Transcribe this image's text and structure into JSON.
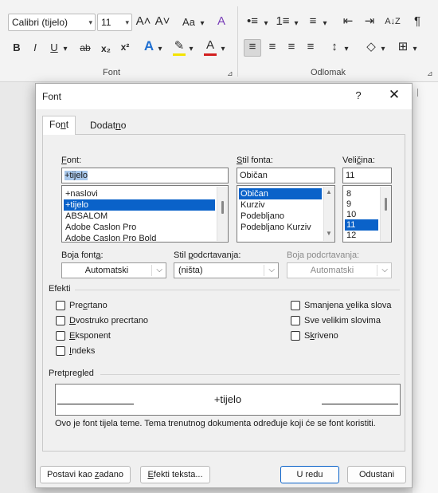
{
  "ribbon": {
    "font_name": "Calibri (tijelo)",
    "font_size": "11",
    "font_group_label": "Font",
    "paragraph_group_label": "Odlomak",
    "icons": {
      "grow": "A˄",
      "shrink": "A˅",
      "change_case": "Aa",
      "clear_format": "A",
      "bold": "B",
      "italic": "I",
      "underline": "U",
      "strike": "ab",
      "subscript": "x₂",
      "superscript": "x²",
      "text_effects": "A",
      "highlight": "✎",
      "font_color": "A",
      "bullets": "•≡",
      "numbering": "1≡",
      "multilevel": "≡",
      "decrease_indent": "⇤",
      "increase_indent": "⇥",
      "sort": "A↓Z",
      "pilcrow": "¶",
      "align_left": "≡",
      "align_center": "≡",
      "align_right": "≡",
      "justify": "≡",
      "line_spacing": "↕",
      "shading": "◇",
      "borders": "⊞"
    },
    "colors": {
      "highlight": "#f4e300",
      "font_color": "#d21f1f",
      "effects": "#1f6fd1"
    }
  },
  "dialog": {
    "title": "Font",
    "help": "?",
    "close": "✕",
    "tabs": {
      "font_pre": "Fo",
      "font_u": "n",
      "font_post": "t",
      "advanced_pre": "Dodat",
      "advanced_u": "n",
      "advanced_post": "o"
    },
    "font_label_u": "F",
    "font_label_rest": "ont:",
    "font_value": "+tijelo",
    "font_list": [
      "+naslovi",
      "+tijelo",
      "ABSALOM",
      "Adobe Caslon Pro",
      "Adobe Caslon Pro Bold"
    ],
    "style_label_u": "S",
    "style_label_rest": "til fonta:",
    "style_value": "Običan",
    "style_list": [
      "Običan",
      "Kurziv",
      "Podebljano",
      "Podebljano Kurziv"
    ],
    "size_label_pre": "Veli",
    "size_label_u": "č",
    "size_label_rest": "ina:",
    "size_value": "11",
    "size_list": [
      "8",
      "9",
      "10",
      "11",
      "12"
    ],
    "color_label_pre": "Boja font",
    "color_label_u": "a",
    "color_label_rest": ":",
    "color_value": "Automatski",
    "underline_label_pre": "Stil ",
    "underline_label_u": "p",
    "underline_label_rest": "odcrtavanja:",
    "underline_value": "(ništa)",
    "underline_color_label": "Boja podcrtavanja:",
    "underline_color_value": "Automatski",
    "effects_label": "Efekti",
    "effects_left": [
      {
        "pre": "Pre",
        "u": "c",
        "post": "rtano"
      },
      {
        "pre": "",
        "u": "D",
        "post": "vostruko precrtano"
      },
      {
        "pre": "",
        "u": "E",
        "post": "ksponent"
      },
      {
        "pre": "",
        "u": "I",
        "post": "ndeks"
      }
    ],
    "effects_right": [
      {
        "pre": "Smanjena ",
        "u": "v",
        "post": "elika slova"
      },
      {
        "pre": "Sve velikim slovima",
        "u": "",
        "post": ""
      },
      {
        "pre": "S",
        "u": "k",
        "post": "riveno"
      }
    ],
    "preview_label": "Pretpregled",
    "preview_text": "+tijelo",
    "description": "Ovo je font tijela teme. Tema trenutnog dokumenta određuje koji će se font koristiti.",
    "buttons": {
      "set_default_pre": "Postavi kao ",
      "set_default_u": "z",
      "set_default_post": "adano",
      "text_effects_pre": "",
      "text_effects_u": "E",
      "text_effects_post": "fekti teksta...",
      "ok": "U redu",
      "cancel": "Odustani"
    }
  }
}
